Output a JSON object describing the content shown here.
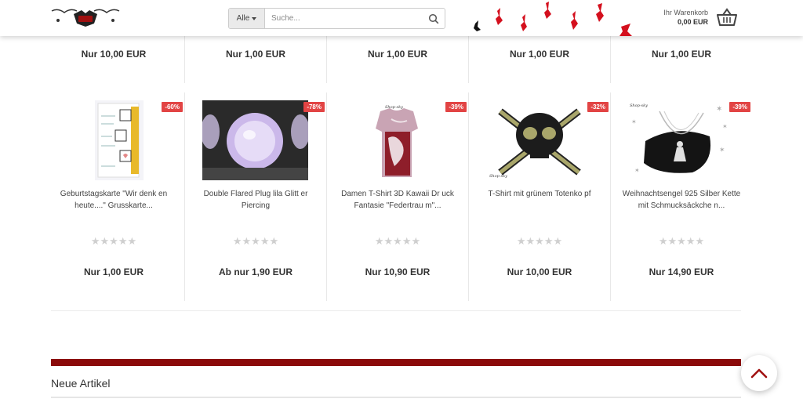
{
  "header": {
    "search": {
      "category": "Alle",
      "placeholder": "Suche..."
    },
    "cart": {
      "label": "Ihr Warenkorb",
      "total": "0,00 EUR"
    }
  },
  "top_prices": [
    "Nur 10,00 EUR",
    "Nur 1,00 EUR",
    "Nur 1,00 EUR",
    "Nur 1,00 EUR",
    "Nur 1,00 EUR"
  ],
  "products": [
    {
      "title": "Geburtstagskarte \"Wir denk en heute....\" Grusskarte...",
      "badge": "-60%",
      "stars": "★★★★★",
      "price": "Nur 1,00 EUR"
    },
    {
      "title": "Double Flared Plug lila Glitt er Piercing",
      "badge": "-78%",
      "stars": "★★★★★",
      "price": "Ab nur 1,90 EUR"
    },
    {
      "title": "Damen T-Shirt 3D Kawaii Dr uck Fantasie \"Federtrau m\"...",
      "badge": "-39%",
      "stars": "★★★★★",
      "price": "Nur 10,90 EUR"
    },
    {
      "title": "T-Shirt mit grünem Totenko pf",
      "badge": "-32%",
      "stars": "★★★★★",
      "price": "Nur 10,00 EUR"
    },
    {
      "title": "Weihnachtsengel 925 Silber Kette mit Schmucksäckche n...",
      "badge": "-39%",
      "stars": "★★★★★",
      "price": "Nur 14,90 EUR"
    }
  ],
  "section": {
    "title": "Neue Artikel"
  },
  "colors": {
    "accent": "#8b0a0a",
    "badge": "#e24444"
  }
}
